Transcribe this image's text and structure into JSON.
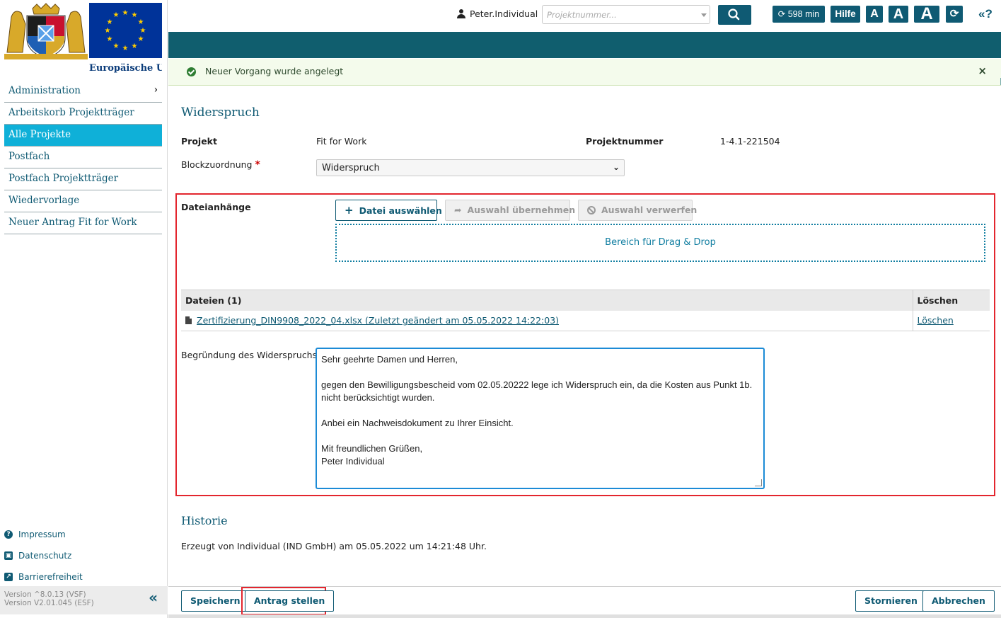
{
  "sidebar": {
    "eu_label": "Europäische Union",
    "nav": [
      {
        "label": "Administration"
      },
      {
        "label": "Arbeitskorb Projektträger"
      },
      {
        "label": "Alle Projekte"
      },
      {
        "label": "Postfach"
      },
      {
        "label": "Postfach Projektträger"
      },
      {
        "label": "Wiedervorlage"
      },
      {
        "label": "Neuer Antrag Fit for Work"
      }
    ],
    "active_item": "Alle Projekte",
    "footer_links": [
      {
        "label": "Impressum",
        "icon": "help-circle-icon"
      },
      {
        "label": "Datenschutz",
        "icon": "id-card-icon"
      },
      {
        "label": "Barrierefreiheit",
        "icon": "external-link-icon"
      }
    ],
    "version_line1": "Version ^8.0.13 (VSF)",
    "version_line2": "Version V2.01.045 (ESF)",
    "collapse_glyph": "«"
  },
  "topbar": {
    "username": "Peter.Individual",
    "project_placeholder": "Projektnummer...",
    "timer": "598 min",
    "help_label": "Hilfe",
    "font_small": "A",
    "font_medium": "A",
    "font_large": "A",
    "collapse_label": "«?"
  },
  "notification": {
    "message": "Neuer Vorgang wurde angelegt",
    "close_glyph": "×"
  },
  "form": {
    "title": "Widerspruch",
    "projekt_label": "Projekt",
    "projekt_value": "Fit for Work",
    "projektnummer_label": "Projektnummer",
    "projektnummer_value": "1-4.1-221504",
    "block_label": "Blockzuordnung",
    "block_required_marker": "*",
    "block_value": "Widerspruch",
    "attachments_label": "Dateianhänge",
    "select_file_label": "Datei auswählen",
    "accept_selection_label": "Auswahl übernehmen",
    "discard_selection_label": "Auswahl verwerfen",
    "dropzone_label": "Bereich für Drag & Drop",
    "files_header": "Dateien (1)",
    "delete_header": "Löschen",
    "files": [
      {
        "name": "Zertifizierung_DIN9908_2022_04.xlsx (Zuletzt geändert am 05.05.2022 14:22:03)",
        "delete_label": "Löschen"
      }
    ],
    "reason_label": "Begründung des Widerspruchs",
    "reason_text": "Sehr geehrte Damen und Herren,\n\ngegen den Bewilligungsbescheid vom 02.05.20222 lege ich Widerspruch ein, da die Kosten aus Punkt 1b.\nnicht berücksichtigt wurden.\n\nAnbei ein Nachweisdokument zu Ihrer Einsicht.\n\nMit freundlichen Grüßen,\nPeter Individual"
  },
  "history": {
    "title": "Historie",
    "text": "Erzeugt von Individual (IND GmbH) am 05.05.2022 um 14:21:48 Uhr."
  },
  "actions": {
    "save": "Speichern",
    "submit": "Antrag stellen",
    "cancel": "Stornieren",
    "abort": "Abbrechen"
  },
  "colors": {
    "brand_teal": "#0f5a73",
    "active_nav": "#0fb0d8",
    "highlight_red": "#e3262e",
    "success_bg": "#f4fbec"
  }
}
